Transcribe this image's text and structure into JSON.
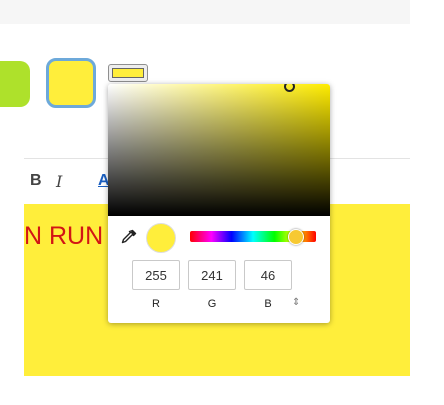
{
  "colors": {
    "accent_green": "#aee12b",
    "selected_yellow": "#ffee3b",
    "selection_border": "#6da9da",
    "text_red": "#d21515"
  },
  "toolbar": {
    "bold_label": "B",
    "italic_label": "I",
    "font_color_label": "A"
  },
  "editor": {
    "text": "N RUN"
  },
  "color_picker": {
    "eyedropper_icon": "eyedropper-icon",
    "hue_fraction": 0.84,
    "rgb": {
      "r": "255",
      "g": "241",
      "b": "46"
    },
    "labels": {
      "r": "R",
      "g": "G",
      "b": "B"
    },
    "mode_toggle": "⇕"
  }
}
